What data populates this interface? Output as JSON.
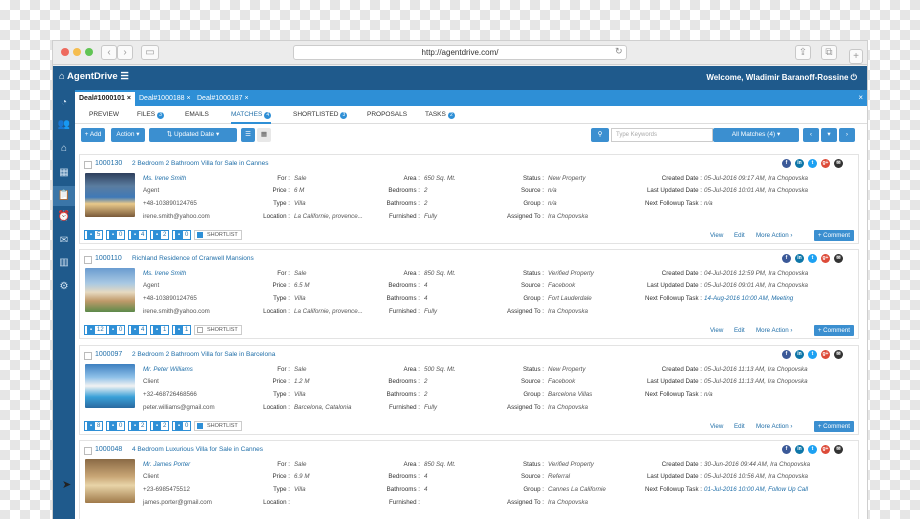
{
  "browser": {
    "url": "http://agentdrive.com/"
  },
  "app": {
    "brand": "AgentDrive",
    "welcome": "Welcome, Wladimir Baranoff-Rossine"
  },
  "deal_tabs": [
    "Deal#1000101",
    "Deal#1000188",
    "Deal#1000187"
  ],
  "sub_tabs": [
    {
      "label": "PREVIEW",
      "badge": ""
    },
    {
      "label": "FILES",
      "badge": "3"
    },
    {
      "label": "EMAILS",
      "badge": ""
    },
    {
      "label": "MATCHES",
      "badge": "4"
    },
    {
      "label": "SHORTLISTED",
      "badge": "3"
    },
    {
      "label": "PROPOSALS",
      "badge": ""
    },
    {
      "label": "TASKS",
      "badge": "2"
    }
  ],
  "toolbar": {
    "add": "+ Add",
    "action": "Action",
    "sort": "Updated Date",
    "search_placeholder": "Type Keywords",
    "filter": "All Matches (4)"
  },
  "labels": {
    "for": "For :",
    "price": "Price :",
    "type": "Type :",
    "location": "Location :",
    "area": "Area :",
    "bedrooms": "Bedrooms :",
    "bathrooms": "Bathrooms :",
    "furnished": "Furnished :",
    "status": "Status :",
    "source": "Source :",
    "group": "Group :",
    "assigned": "Assigned To :",
    "created": "Created Date :",
    "updated": "Last Updated Date :",
    "followup": "Next Followup Task :",
    "view": "View",
    "edit": "Edit",
    "more": "More Action",
    "comment": "+ Comment",
    "shortlist": "SHORTLIST"
  },
  "listings": [
    {
      "id": "1000130",
      "title": "2 Bedroom 2 Bathroom Villa for Sale in Cannes",
      "agent_name": "Ms. Irene Smith",
      "agent_role": "Agent",
      "phone": "+48-103890124765",
      "email": "irene.smith@yahoo.com",
      "for": "Sale",
      "price": "6 M",
      "type": "Villa",
      "location": "La Californie, provence...",
      "area": "650 Sq. Mt.",
      "bedrooms": "2",
      "bathrooms": "2",
      "furnished": "Fully",
      "status": "New Property",
      "source": "n/a",
      "group": "n/a",
      "assigned": "Ira Chopovska",
      "created": "05-Jul-2016 09:17 AM, Ira Chopovska",
      "updated": "05-Jul-2016 10:01 AM, Ira Chopovska",
      "followup": "n/a",
      "counts": [
        "5",
        "0",
        "4",
        "2",
        "0"
      ],
      "shortlisted": true
    },
    {
      "id": "1000110",
      "title": "Richland Residence of Cranwell Mansions",
      "agent_name": "Ms. Irene Smith",
      "agent_role": "Agent",
      "phone": "+48-103890124765",
      "email": "irene.smith@yahoo.com",
      "for": "Sale",
      "price": "6.5 M",
      "type": "Villa",
      "location": "La Californie, provence...",
      "area": "850 Sq. Mt.",
      "bedrooms": "4",
      "bathrooms": "4",
      "furnished": "Fully",
      "status": "Verified Property",
      "source": "Facebook",
      "group": "Fort Lauderdale",
      "assigned": "Ira Chopovska",
      "created": "04-Jul-2016 12:59 PM, Ira Chopovska",
      "updated": "05-Jul-2016 09:01 AM, Ira Chopovska",
      "followup": "14-Aug-2016 10:00 AM, Meeting",
      "counts": [
        "12",
        "0",
        "4",
        "1",
        "1"
      ],
      "shortlisted": false
    },
    {
      "id": "1000097",
      "title": "2 Bedroom 2 Bathroom Villa for Sale in Barcelona",
      "agent_name": "Mr. Peter Williams",
      "agent_role": "Client",
      "phone": "+32-468726468566",
      "email": "peter.williams@gmail.com",
      "for": "Sale",
      "price": "1.2 M",
      "type": "Villa",
      "location": "Barcelona, Catalonia",
      "area": "500 Sq. Mt.",
      "bedrooms": "2",
      "bathrooms": "2",
      "furnished": "Fully",
      "status": "New Property",
      "source": "Facebook",
      "group": "Barcelona Villas",
      "assigned": "Ira Chopovska",
      "created": "05-Jul-2016 11:13 AM, Ira Chopovska",
      "updated": "05-Jul-2016 11:13 AM, Ira Chopovska",
      "followup": "n/a",
      "counts": [
        "8",
        "0",
        "2",
        "2",
        "0"
      ],
      "shortlisted": true
    },
    {
      "id": "1000048",
      "title": "4 Bedroom Luxurious Villa for Sale in Cannes",
      "agent_name": "Mr. James Porter",
      "agent_role": "Client",
      "phone": "+23-6985475512",
      "email": "james.porter@gmail.com",
      "for": "Sale",
      "price": "6.9 M",
      "type": "Villa",
      "location": "",
      "area": "850 Sq. Mt.",
      "bedrooms": "4",
      "bathrooms": "4",
      "furnished": "",
      "status": "Verified Property",
      "source": "Referral",
      "group": "Cannes La Californie",
      "assigned": "Ira Chopovska",
      "created": "30-Jun-2016 09:44 AM, Ira Chopovska",
      "updated": "05-Jul-2016 10:56 AM, Ira Chopovska",
      "followup": "01-Jul-2016 10:00 AM, Follow Up Call",
      "counts": [],
      "shortlisted": false
    }
  ],
  "colors": {
    "brand": "#1f5a8c",
    "accent": "#2e8fd6"
  }
}
